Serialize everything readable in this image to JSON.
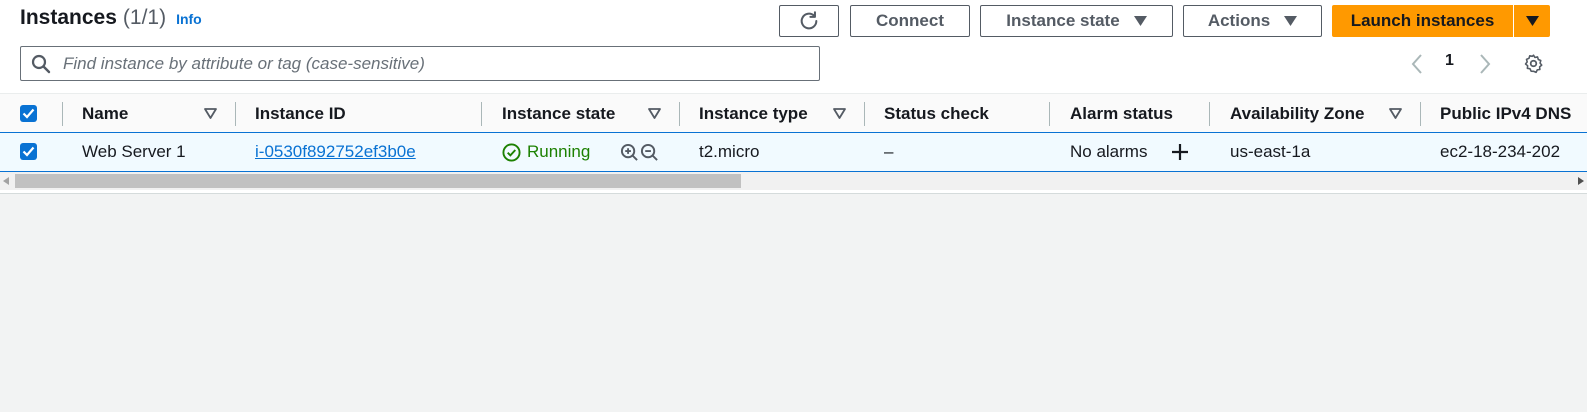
{
  "header": {
    "title": "Instances",
    "count": "(1/1)",
    "info_link": "Info"
  },
  "toolbar": {
    "refresh_icon": "refresh-icon",
    "connect_label": "Connect",
    "instance_state_label": "Instance state",
    "actions_label": "Actions",
    "launch_label": "Launch instances"
  },
  "search": {
    "placeholder": "Find instance by attribute or tag (case-sensitive)",
    "value": ""
  },
  "pagination": {
    "current_page": "1"
  },
  "table": {
    "columns": [
      "Name",
      "Instance ID",
      "Instance state",
      "Instance type",
      "Status check",
      "Alarm status",
      "Availability Zone",
      "Public IPv4 DNS"
    ],
    "rows": [
      {
        "name": "Web Server 1",
        "instance_id": "i-0530f892752ef3b0e",
        "state": "Running",
        "type": "t2.micro",
        "status_check": "–",
        "alarm_status": "No alarms",
        "availability_zone": "us-east-1a",
        "public_dns": "ec2-18-234-202"
      }
    ]
  },
  "scrollbar": {
    "position_fraction": 0.0,
    "visible_fraction": 0.47
  },
  "colors": {
    "accent": "#0972d3",
    "primary_button": "#ff9900",
    "running": "#1d8102",
    "selected_row": "#f1faff"
  }
}
